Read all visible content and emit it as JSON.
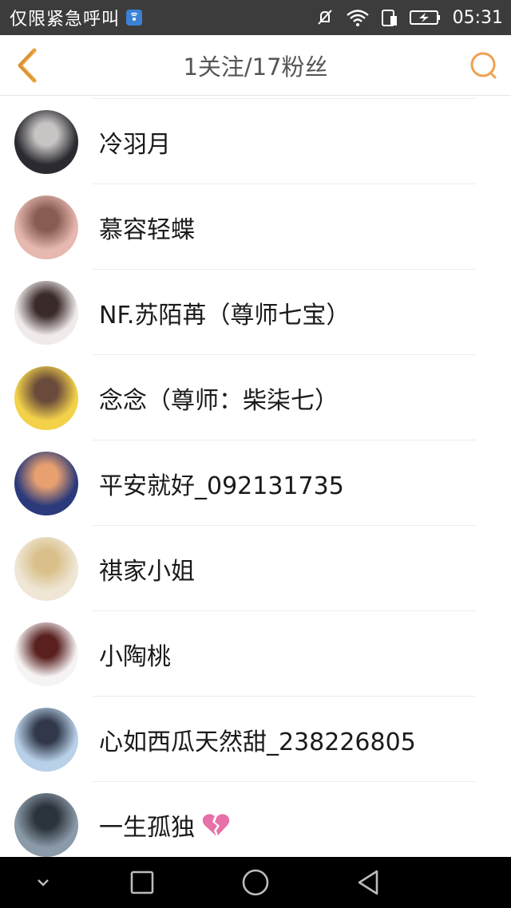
{
  "status_bar": {
    "carrier": "仅限紧急呼叫",
    "time": "05:31"
  },
  "header": {
    "title": "1关注/17粉丝",
    "accent_color": "#e8a13a",
    "search_color": "#f0a050"
  },
  "fans": [
    {
      "name": "冷羽月",
      "avatar_colors": [
        "#2a2a30",
        "#c9c4c4"
      ]
    },
    {
      "name": "慕容轻蝶",
      "avatar_colors": [
        "#e6b8b0",
        "#8a5b50"
      ]
    },
    {
      "name": "NF.苏陌苒（尊师七宝）",
      "avatar_colors": [
        "#f0eaea",
        "#3a2a2a"
      ]
    },
    {
      "name": "念念（尊师：柴柒七）",
      "avatar_colors": [
        "#f3d24a",
        "#6a4a3a"
      ]
    },
    {
      "name": "平安就好_092131735",
      "avatar_colors": [
        "#2a3a7a",
        "#e8a070"
      ]
    },
    {
      "name": "祺家小姐",
      "avatar_colors": [
        "#efe6d6",
        "#d9c08a"
      ]
    },
    {
      "name": "小陶桃",
      "avatar_colors": [
        "#f5f3f3",
        "#5a2020"
      ]
    },
    {
      "name": "心如西瓜天然甜_238226805",
      "avatar_colors": [
        "#b8d0e8",
        "#30384a"
      ]
    },
    {
      "name": "一生孤独",
      "avatar_colors": [
        "#8a9aa8",
        "#2a323a"
      ],
      "emoji_icon": "broken-heart-icon"
    }
  ],
  "nav": {
    "icons": [
      "collapse-icon",
      "recents-icon",
      "home-icon",
      "back-icon"
    ]
  }
}
